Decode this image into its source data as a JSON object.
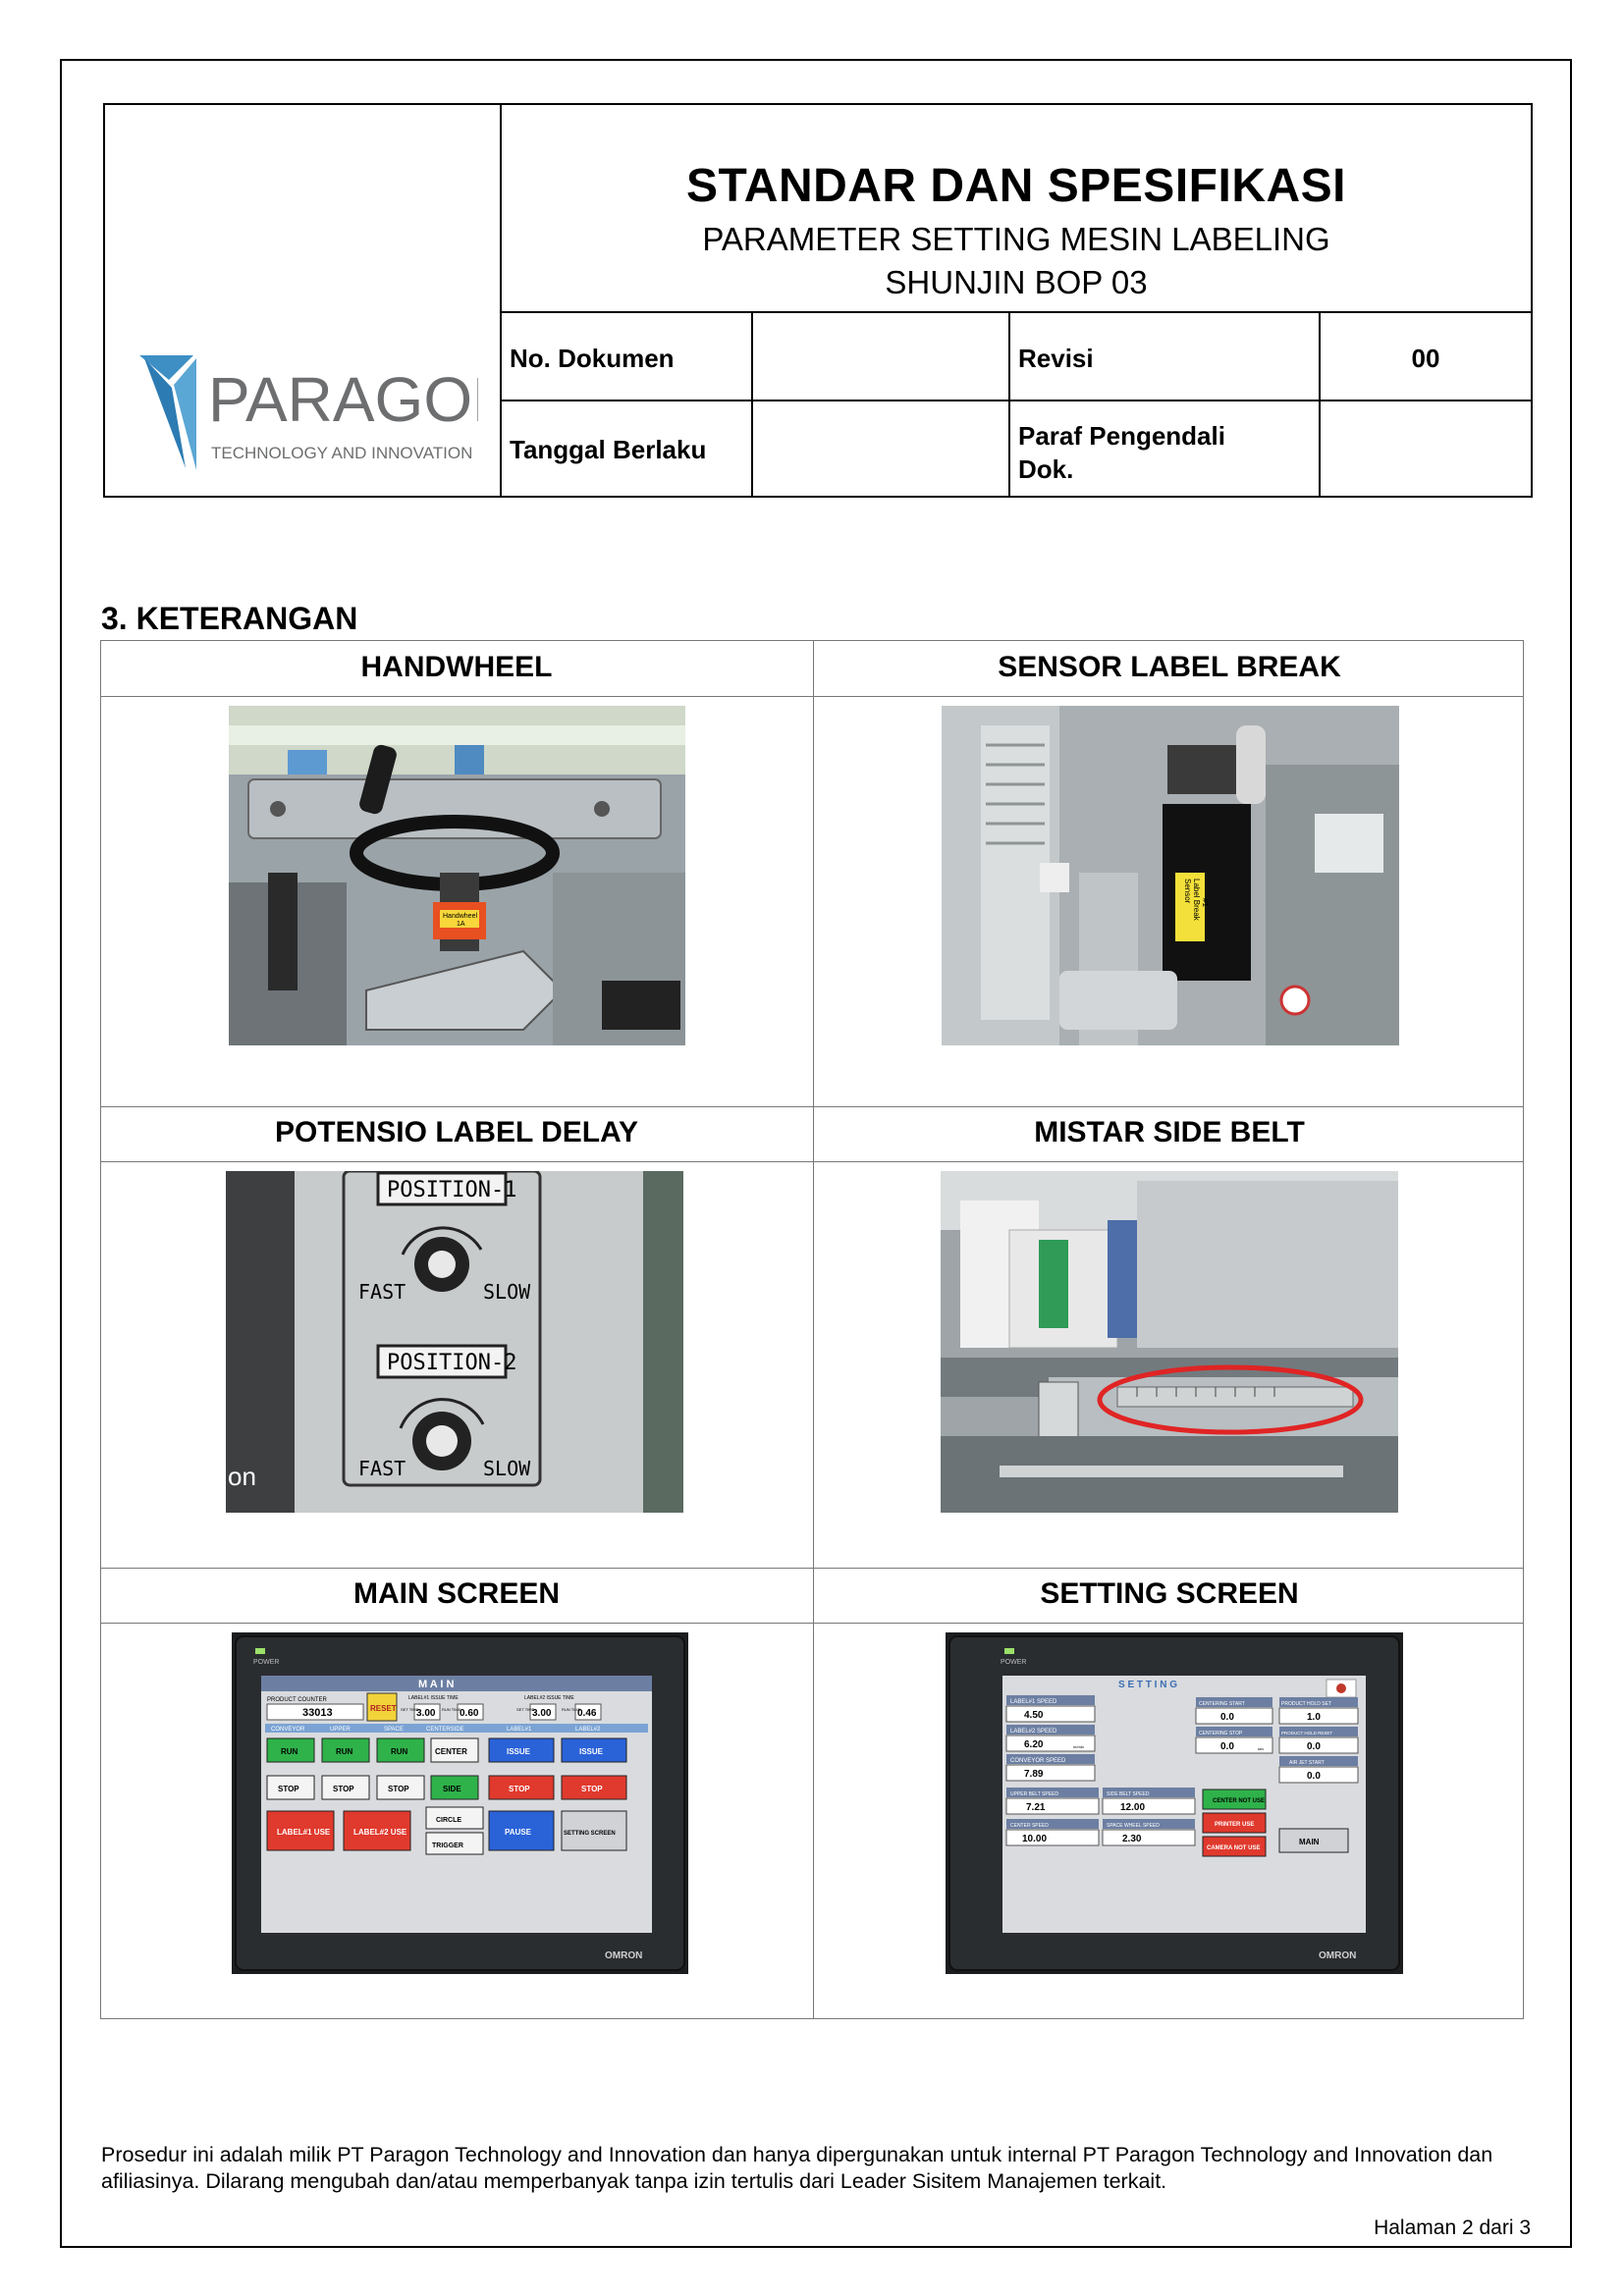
{
  "header": {
    "logo": {
      "brand": "PARAGON",
      "tagline": "TECHNOLOGY AND INNOVATION"
    },
    "title": "STANDAR DAN SPESIFIKASI",
    "subtitle_1": "PARAMETER SETTING MESIN LABELING",
    "subtitle_2": "SHUNJIN BOP 03",
    "fields": {
      "no_dokumen_label": "No. Dokumen",
      "no_dokumen_value": "",
      "revisi_label": "Revisi",
      "revisi_value": "00",
      "tanggal_label": "Tanggal Berlaku",
      "tanggal_value": "",
      "paraf_label": "Paraf Pengendali Dok.",
      "paraf_value": ""
    }
  },
  "section": {
    "heading": "3. KETERANGAN"
  },
  "items": [
    {
      "label": "HANDWHEEL",
      "photo_text": [
        "Handwheel",
        "1A"
      ]
    },
    {
      "label": "SENSOR LABEL BREAK",
      "photo_text": [
        "Sensor",
        "Label Break",
        "#1"
      ]
    },
    {
      "label": "POTENSIO LABEL DELAY",
      "photo_text": [
        "POSITION-1",
        "FAST",
        "SLOW",
        "POSITION-2",
        "FAST",
        "SLOW",
        "on"
      ]
    },
    {
      "label": "MISTAR SIDE BELT",
      "photo_text": []
    },
    {
      "label": "MAIN SCREEN",
      "photo_text": [
        "POWER",
        "M A I N",
        "PRODUCT COUNTER",
        "33013",
        "RESET",
        "LABEL#1 ISSUE TIME",
        "3.00",
        "0.60",
        "LABEL#2 ISSUE TIME",
        "3.00",
        "0.46",
        "SET TIME",
        "RUN TIME",
        "SET TIME",
        "RUN TIME",
        "CONVEYOR",
        "UPPER",
        "SPACE",
        "CENTERSIDE",
        "LABEL#1",
        "LABEL#2",
        "RUN",
        "RUN",
        "RUN",
        "CENTER",
        "ISSUE",
        "ISSUE",
        "STOP",
        "STOP",
        "STOP",
        "SIDE",
        "STOP",
        "STOP",
        "CIRCLE",
        "TRIGGER",
        "LABEL#1 USE",
        "LABEL#2 USE",
        "PAUSE",
        "SETTING SCREEN",
        "OMRON"
      ]
    },
    {
      "label": "SETTING SCREEN",
      "photo_text": [
        "POWER",
        "S E T T I N G",
        "LABEL#1 SPEED",
        "4.50",
        "LABEL#2 SPEED",
        "6.20",
        "CONVEYOR SPEED",
        "7.89",
        "UPPER BELT SPEED",
        "7.21",
        "SIDE BELT SPEED",
        "12.00",
        "CENTER SPEED",
        "10.00",
        "SPACE WHEEL SPEED",
        "2.30",
        "CENTERING START",
        "0.0",
        "CENTERING STOP",
        "0.0",
        "PRODUCT HOLD SET",
        "1.0",
        "PRODUCT HOLD RESET",
        "0.0",
        "AIR JET START",
        "0.0",
        "CENTER NOT USE",
        "PRINTER USE",
        "CAMERA NOT USE",
        "MAIN",
        "OMRON",
        "m/min",
        "sec"
      ]
    }
  ],
  "footer": {
    "text": "Prosedur ini adalah milik PT Paragon Technology and Innovation dan hanya dipergunakan untuk internal PT Paragon Technology and Innovation dan afiliasinya. Dilarang mengubah dan/atau memperbanyak tanpa izin tertulis dari Leader Sisitem Manajemen terkait.",
    "page": "Halaman 2 dari 3"
  },
  "colors": {
    "brand_blue": "#3d8fc4",
    "brand_gray": "#6d6e70",
    "hmi_green": "#2fb24a",
    "hmi_red": "#e0392d",
    "hmi_blue": "#2a62d8",
    "hmi_yellow": "#f2d33a",
    "ruler_highlight": "#e02424"
  }
}
